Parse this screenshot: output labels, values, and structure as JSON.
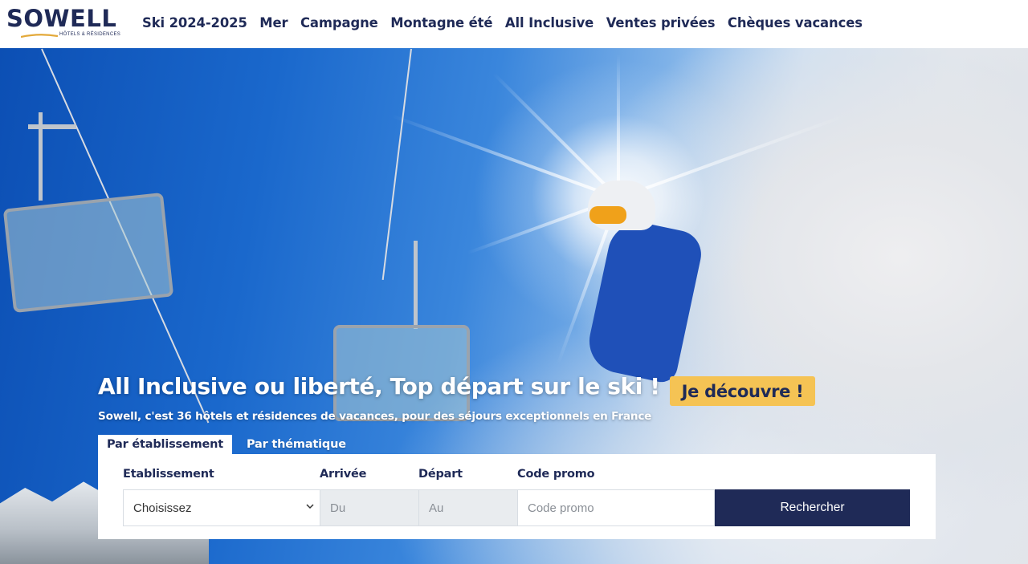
{
  "brand": {
    "name": "SOWELL",
    "tagline": "HÔTELS & RÉSIDENCES"
  },
  "nav": {
    "items": [
      {
        "label": "Ski 2024-2025"
      },
      {
        "label": "Mer"
      },
      {
        "label": "Campagne"
      },
      {
        "label": "Montagne été"
      },
      {
        "label": "All Inclusive"
      },
      {
        "label": "Ventes privées"
      },
      {
        "label": "Chèques vacances"
      }
    ]
  },
  "hero": {
    "headline": "All Inclusive ou liberté, Top départ sur le ski !",
    "cta_label": "Je découvre !",
    "subline": "Sowell, c'est 36 hôtels et résidences de vacances, pour des séjours exceptionnels en France"
  },
  "search": {
    "tabs": [
      {
        "label": "Par établissement",
        "active": true
      },
      {
        "label": "Par thématique",
        "active": false
      }
    ],
    "fields": {
      "establishment_label": "Etablissement",
      "establishment_value": "Choisissez",
      "arrival_label": "Arrivée",
      "arrival_placeholder": "Du",
      "departure_label": "Départ",
      "departure_placeholder": "Au",
      "promo_label": "Code promo",
      "promo_placeholder": "Code promo"
    },
    "submit_label": "Rechercher"
  },
  "colors": {
    "brand_navy": "#1f2a57",
    "cta_yellow": "#f5c354",
    "logo_gold": "#e3a93a"
  }
}
